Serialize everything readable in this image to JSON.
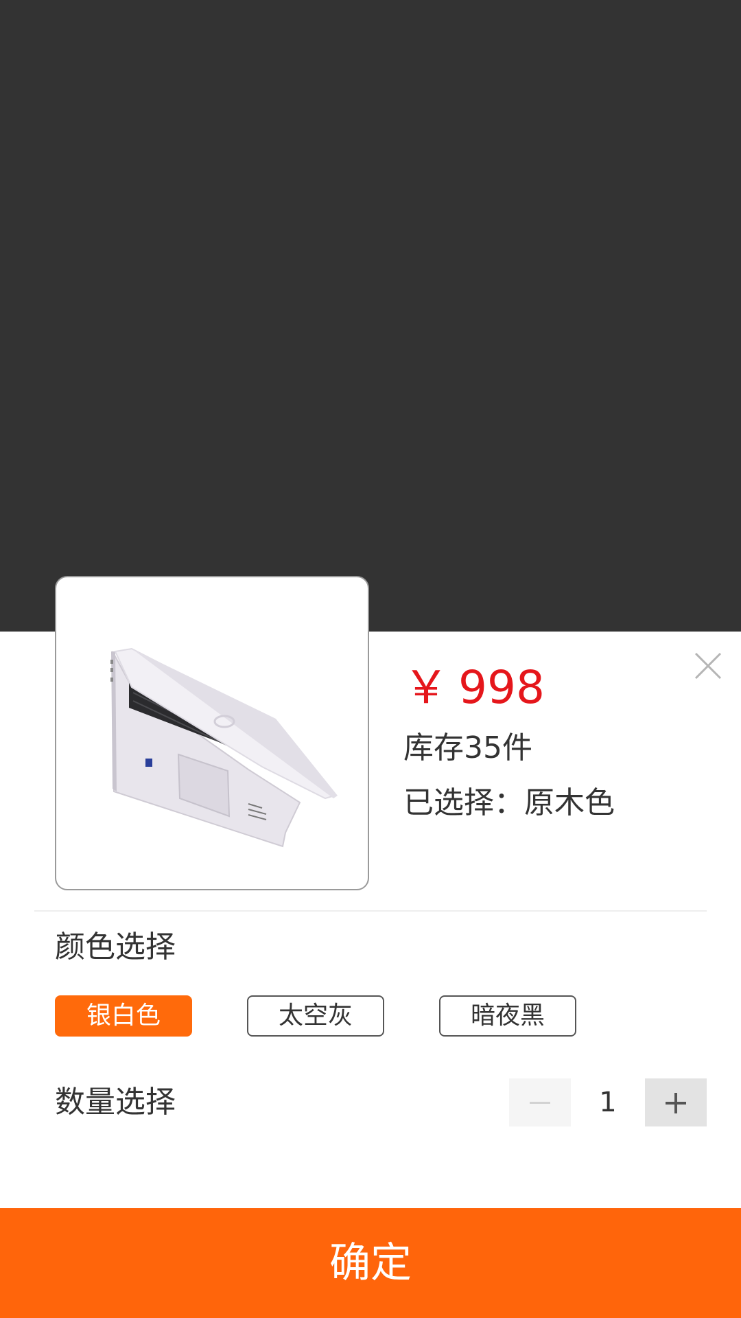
{
  "product": {
    "currency_symbol": "￥",
    "price": "998",
    "stock_text": "库存35件",
    "selected_text": "已选择：原木色"
  },
  "color_section": {
    "title": "颜色选择",
    "options": [
      {
        "label": "银白色",
        "selected": true
      },
      {
        "label": "太空灰",
        "selected": false
      },
      {
        "label": "暗夜黑",
        "selected": false
      }
    ]
  },
  "quantity_section": {
    "title": "数量选择",
    "value": "1"
  },
  "confirm_label": "确定",
  "colors": {
    "overlay": "#333333",
    "accent": "#ff650b",
    "price": "#e5161b"
  },
  "icons": {
    "close": "close-icon",
    "minus": "minus-icon",
    "plus": "plus-icon"
  }
}
